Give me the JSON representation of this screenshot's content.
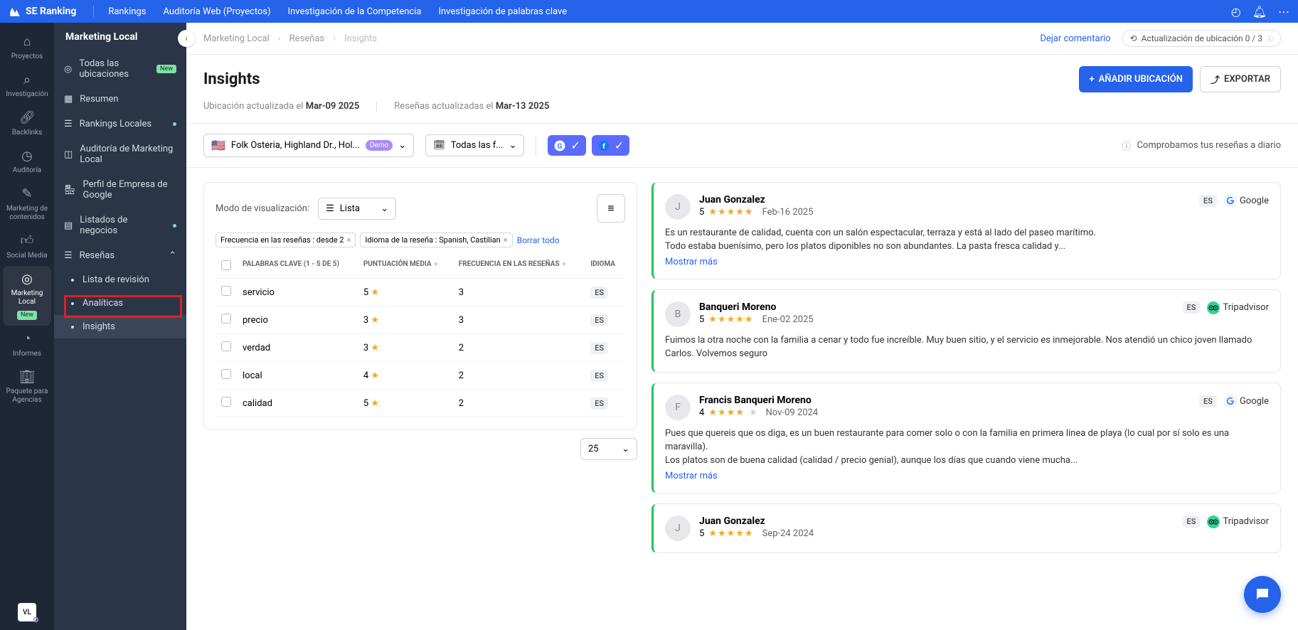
{
  "topnav": {
    "brand": "SE Ranking",
    "items": [
      "Rankings",
      "Auditoría Web (Proyectos)",
      "Investigación de la Competencia",
      "Investigación de palabras clave"
    ]
  },
  "rail": {
    "items": [
      {
        "label": "Proyectos"
      },
      {
        "label": "Investigación"
      },
      {
        "label": "Backlinks"
      },
      {
        "label": "Auditoría"
      },
      {
        "label": "Marketing de contenidos"
      },
      {
        "label": "Social Media"
      },
      {
        "label": "Marketing Local",
        "active": true,
        "badge": "New"
      },
      {
        "label": "Informes"
      },
      {
        "label": "Paquete para Agencias"
      }
    ],
    "avatar": "VL"
  },
  "sidebar": {
    "title": "Marketing Local",
    "items": [
      {
        "label": "Todas las ubicaciones",
        "tag": "New"
      },
      {
        "label": "Resumen"
      },
      {
        "label": "Rankings Locales",
        "dot": true
      },
      {
        "label": "Auditoría de Marketing Local"
      },
      {
        "label": "Perfil de Empresa de Google"
      },
      {
        "label": "Listados de negocios",
        "dot": true
      },
      {
        "label": "Reseñas",
        "expanded": true
      }
    ],
    "sub": [
      {
        "label": "Lista de revisión"
      },
      {
        "label": "Analíticas"
      },
      {
        "label": "Insights",
        "active": true
      }
    ]
  },
  "crumbs": {
    "a": "Marketing Local",
    "b": "Reseñas",
    "c": "Insights",
    "comment": "Dejar comentario",
    "status": "Actualización de ubicación  0 / 3"
  },
  "header": {
    "title": "Insights",
    "add_btn": "AÑADIR UBICACIÓN",
    "export_btn": "EXPORTAR",
    "meta1_label": "Ubicación actualizada el",
    "meta1_value": "Mar-09 2025",
    "meta2_label": "Reseñas actualizadas el",
    "meta2_value": "Mar-13 2025"
  },
  "filters": {
    "location": "Folk Osteria, Highland Dr., Hol...",
    "demo": "Demo",
    "date": "Todas las f...",
    "info": "Comprobamos tus reseñas a diario"
  },
  "viewmode": {
    "label": "Modo de visualización:",
    "value": "Lista"
  },
  "chips": {
    "c1": "Frecuencia en las reseñas : desde 2",
    "c2": "Idioma de la reseña : Spanish, Castilian",
    "clear": "Borrar todo"
  },
  "kw_table": {
    "h1": "PALABRAS CLAVE (1 - 5 DE 5)",
    "h2": "PUNTUACIÓN MEDIA",
    "h3": "FRECUENCIA EN LAS RESEÑAS",
    "h4": "IDIOMA",
    "rows": [
      {
        "kw": "servicio",
        "score": "5",
        "freq": "3",
        "lang": "ES"
      },
      {
        "kw": "precio",
        "score": "3",
        "freq": "3",
        "lang": "ES"
      },
      {
        "kw": "verdad",
        "score": "3",
        "freq": "2",
        "lang": "ES"
      },
      {
        "kw": "local",
        "score": "4",
        "freq": "2",
        "lang": "ES"
      },
      {
        "kw": "calidad",
        "score": "5",
        "freq": "2",
        "lang": "ES"
      }
    ],
    "page_size": "25"
  },
  "reviews": [
    {
      "initial": "J",
      "name": "Juan Gonzalez",
      "rating": "5",
      "stars": "★★★★★",
      "date": "Feb-16 2025",
      "lang": "ES",
      "source": "Google",
      "src_type": "g",
      "body": "Es un restaurante de calidad, cuenta con un salón espectacular, terraza y está al lado del paseo marítimo.\nTodo estaba buenísimo, pero los platos diponibles no son abundantes. La pasta fresca calidad y...",
      "more": "Mostrar más"
    },
    {
      "initial": "B",
      "name": "Banqueri Moreno",
      "rating": "5",
      "stars": "★★★★★",
      "date": "Ene-02 2025",
      "lang": "ES",
      "source": "Tripadvisor",
      "src_type": "ta",
      "body": "Fuimos la otra noche con la familia a cenar y todo fue increíble. Muy buen sitio, y el servicio es inmejorable. Nos atendió un chico joven llamado Carlos. Volvemos seguro"
    },
    {
      "initial": "F",
      "name": "Francis Banqueri Moreno",
      "rating": "4",
      "stars": "★★★★",
      "empty": "★",
      "date": "Nov-09 2024",
      "lang": "ES",
      "source": "Google",
      "src_type": "g",
      "body": "Pues que quereis que os diga, es un buen restaurante para comer solo o con la familia en primera linea de playa (lo cual por sí solo es una maravilla).\nLos platos son de buena calidad (calidad / precio genial), aunque los días que cuando viene mucha...",
      "more": "Mostrar más"
    },
    {
      "initial": "J",
      "name": "Juan Gonzalez",
      "rating": "5",
      "stars": "★★★★★",
      "date": "Sep-24 2024",
      "lang": "ES",
      "source": "Tripadvisor",
      "src_type": "ta",
      "body": ""
    }
  ]
}
